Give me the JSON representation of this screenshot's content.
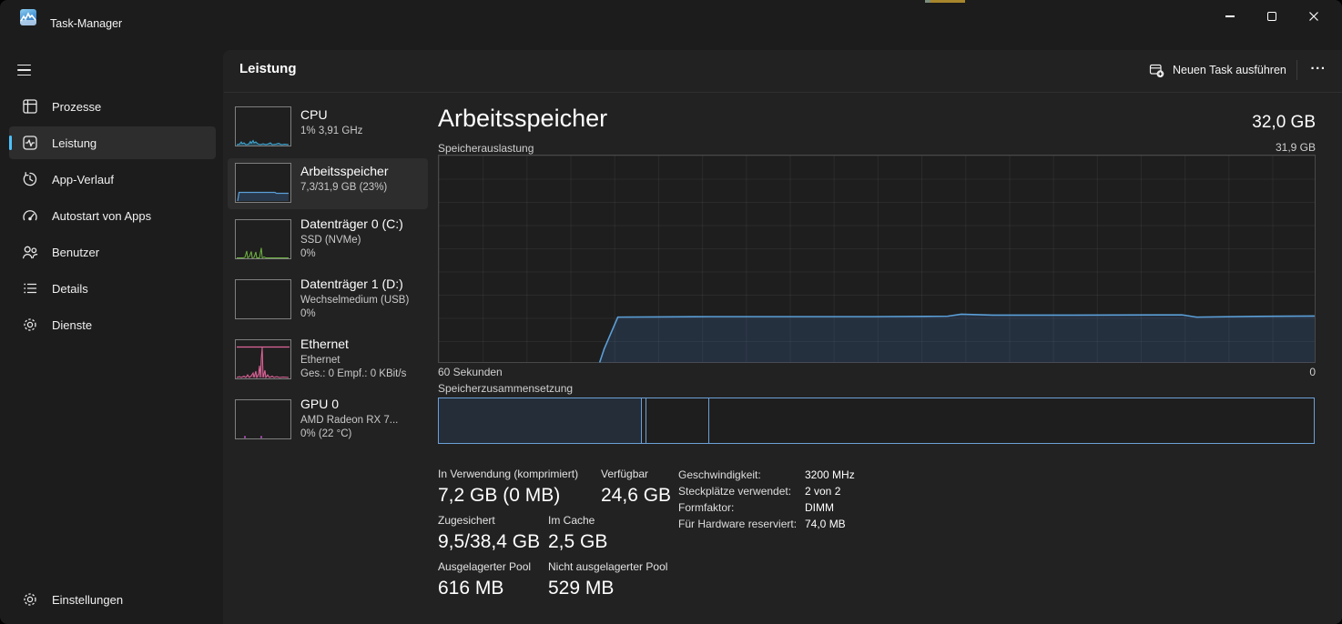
{
  "app": {
    "title": "Task-Manager"
  },
  "sidebar": {
    "items": [
      {
        "label": "Prozesse"
      },
      {
        "label": "Leistung"
      },
      {
        "label": "App-Verlauf"
      },
      {
        "label": "Autostart von Apps"
      },
      {
        "label": "Benutzer"
      },
      {
        "label": "Details"
      },
      {
        "label": "Dienste"
      }
    ],
    "settings": "Einstellungen"
  },
  "header": {
    "title": "Leistung",
    "run_new_task": "Neuen Task ausführen",
    "more": "..."
  },
  "devices": [
    {
      "name": "CPU",
      "line1": "1% 3,91 GHz",
      "line2": ""
    },
    {
      "name": "Arbeitsspeicher",
      "line1": "7,3/31,9 GB (23%)",
      "line2": ""
    },
    {
      "name": "Datenträger 0 (C:)",
      "line1": "SSD (NVMe)",
      "line2": "0%"
    },
    {
      "name": "Datenträger 1 (D:)",
      "line1": "Wechselmedium (USB)",
      "line2": "0%"
    },
    {
      "name": "Ethernet",
      "line1": "Ethernet",
      "line2": "Ges.: 0 Empf.: 0 KBit/s"
    },
    {
      "name": "GPU 0",
      "line1": "AMD Radeon RX 7...",
      "line2": "0% (22 °C)"
    }
  ],
  "memory": {
    "title": "Arbeitsspeicher",
    "total": "32,0 GB",
    "usage_label": "Speicherauslastung",
    "scale_top": "31,9 GB",
    "time_left": "60 Sekunden",
    "time_right": "0",
    "composition_label": "Speicherzusammensetzung",
    "stats": [
      [
        {
          "label": "In Verwendung (komprimiert)",
          "value": "7,2 GB (0 MB)"
        },
        {
          "label": "Verfügbar",
          "value": "24,6 GB"
        }
      ],
      [
        {
          "label": "Zugesichert",
          "value": "9,5/38,4 GB"
        },
        {
          "label": "Im Cache",
          "value": "2,5 GB"
        }
      ],
      [
        {
          "label": "Ausgelagerter Pool",
          "value": "616 MB"
        },
        {
          "label": "Nicht ausgelagerter Pool",
          "value": "529 MB"
        }
      ]
    ],
    "details": [
      {
        "label": "Geschwindigkeit:",
        "value": "3200 MHz"
      },
      {
        "label": "Steckplätze verwendet:",
        "value": "2 von 2"
      },
      {
        "label": "Formfaktor:",
        "value": "DIMM"
      },
      {
        "label": "Für Hardware reserviert:",
        "value": "74,0 MB"
      }
    ]
  },
  "colors": {
    "accent": "#4cc2ff",
    "chart_line": "#5b9fd8",
    "chart_fill": "rgba(66,115,180,0.22)",
    "composition_border": "#6ca0d8",
    "cpu_spark": "#3fa9d6",
    "disk_spark": "#6db33f",
    "net_spark": "#e0649a",
    "gpu_spark": "#b44fc2"
  },
  "chart_data": {
    "type": "area",
    "title": "Speicherauslastung",
    "xlabel_left": "60 Sekunden",
    "xlabel_right": "0",
    "ylim_gb": [
      0,
      31.9
    ],
    "x_seconds_ago": [
      60,
      48,
      46,
      44,
      40,
      30,
      25,
      24,
      20,
      10,
      8,
      0
    ],
    "usage_gb": [
      0,
      0,
      3.5,
      7.1,
      7.2,
      7.2,
      7.2,
      7.5,
      7.4,
      7.4,
      7.1,
      7.3
    ],
    "legend_position": "none",
    "grid": true,
    "composition_segments_pct": [
      {
        "name": "in_use",
        "from": 0,
        "to": 23.2
      },
      {
        "name": "modified",
        "from": 23.2,
        "to": 23.6
      },
      {
        "name": "standby_cache",
        "from": 23.6,
        "to": 30.8
      },
      {
        "name": "free",
        "from": 30.8,
        "to": 100
      }
    ]
  }
}
